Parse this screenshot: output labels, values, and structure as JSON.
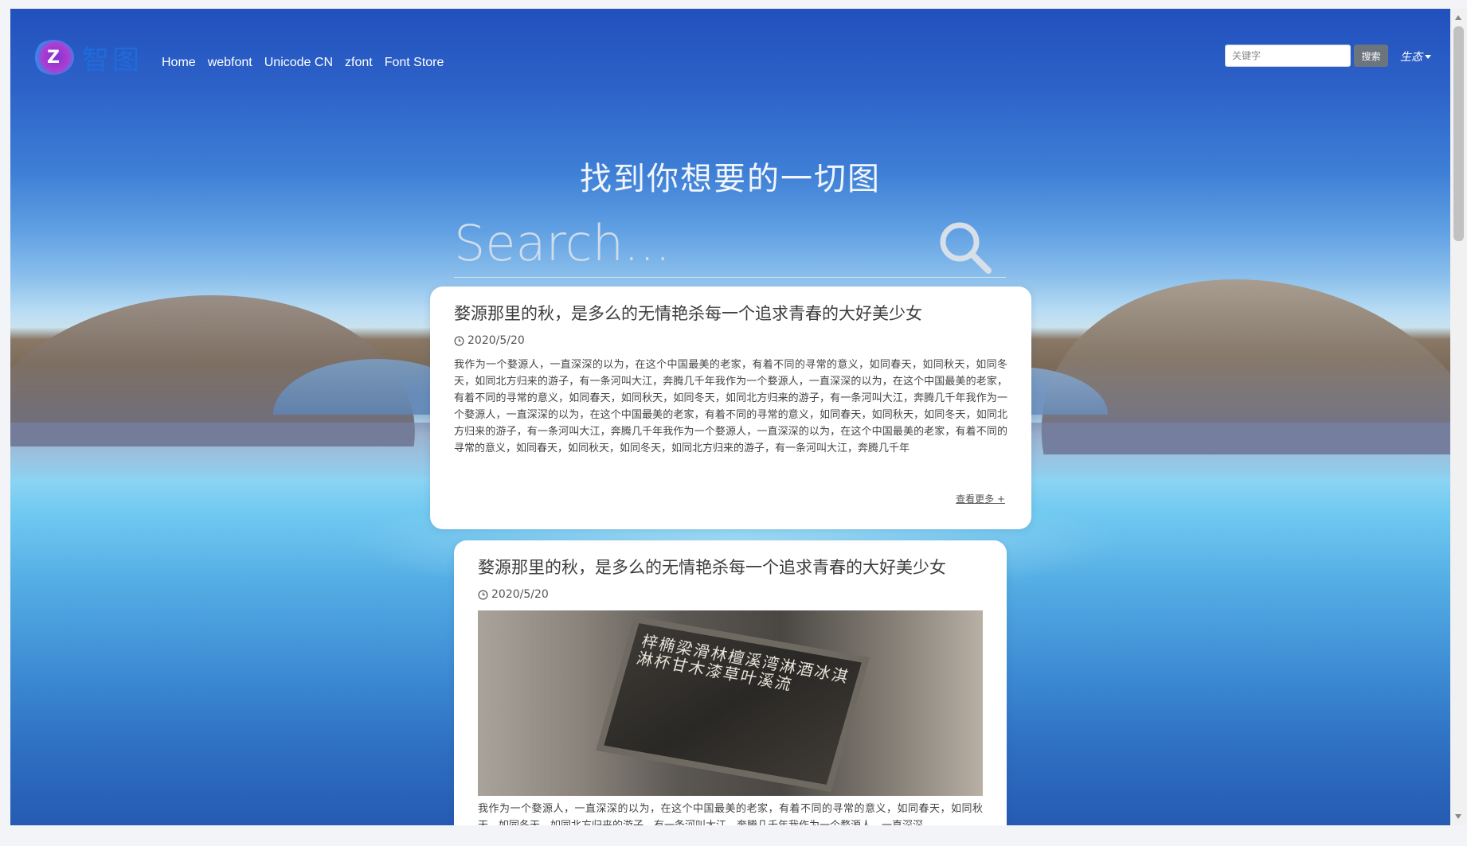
{
  "brand": {
    "logo_letter": "Z",
    "logo_text": "智图"
  },
  "nav": {
    "links": [
      "Home",
      "webfont",
      "Unicode CN",
      "zfont",
      "Font Store"
    ]
  },
  "header_search": {
    "placeholder": "关键字",
    "button_label": "搜索"
  },
  "ecosystem_menu": {
    "label": "生态"
  },
  "hero": {
    "title": "找到你想要的一切图",
    "search_placeholder": "Search..."
  },
  "cards": [
    {
      "title": "婺源那里的秋，是多么的无情艳杀每一个追求青春的大好美少女",
      "date": "2020/5/20",
      "body": "我作为一个婺源人，一直深深的以为，在这个中国最美的老家，有着不同的寻常的意义，如同春天，如同秋天，如同冬天，如同北方归来的游子，有一条河叫大江，奔腾几千年我作为一个婺源人，一直深深的以为，在这个中国最美的老家，有着不同的寻常的意义，如同春天，如同秋天，如同冬天，如同北方归来的游子，有一条河叫大江，奔腾几千年我作为一个婺源人，一直深深的以为，在这个中国最美的老家，有着不同的寻常的意义，如同春天，如同秋天，如同冬天，如同北方归来的游子，有一条河叫大江，奔腾几千年我作为一个婺源人，一直深深的以为，在这个中国最美的老家，有着不同的寻常的意义，如同春天，如同秋天，如同冬天，如同北方归来的游子，有一条河叫大江，奔腾几千年",
      "more": "查看更多 +"
    },
    {
      "title": "婺源那里的秋，是多么的无情艳杀每一个追求青春的大好美少女",
      "date": "2020/5/20",
      "image_glyphs": "梓椭梁滑林檀溪湾淋酒冰淇淋杯甘木漆草叶溪流",
      "body": "我作为一个婺源人，一直深深的以为，在这个中国最美的老家，有着不同的寻常的意义，如同春天，如同秋天，如同冬天，如同北方归来的游子，有一条河叫大江，奔腾几千年我作为一个婺源人，一直深深"
    }
  ],
  "colors": {
    "accent": "#1d6fe0",
    "search_button": "#6c747d"
  }
}
